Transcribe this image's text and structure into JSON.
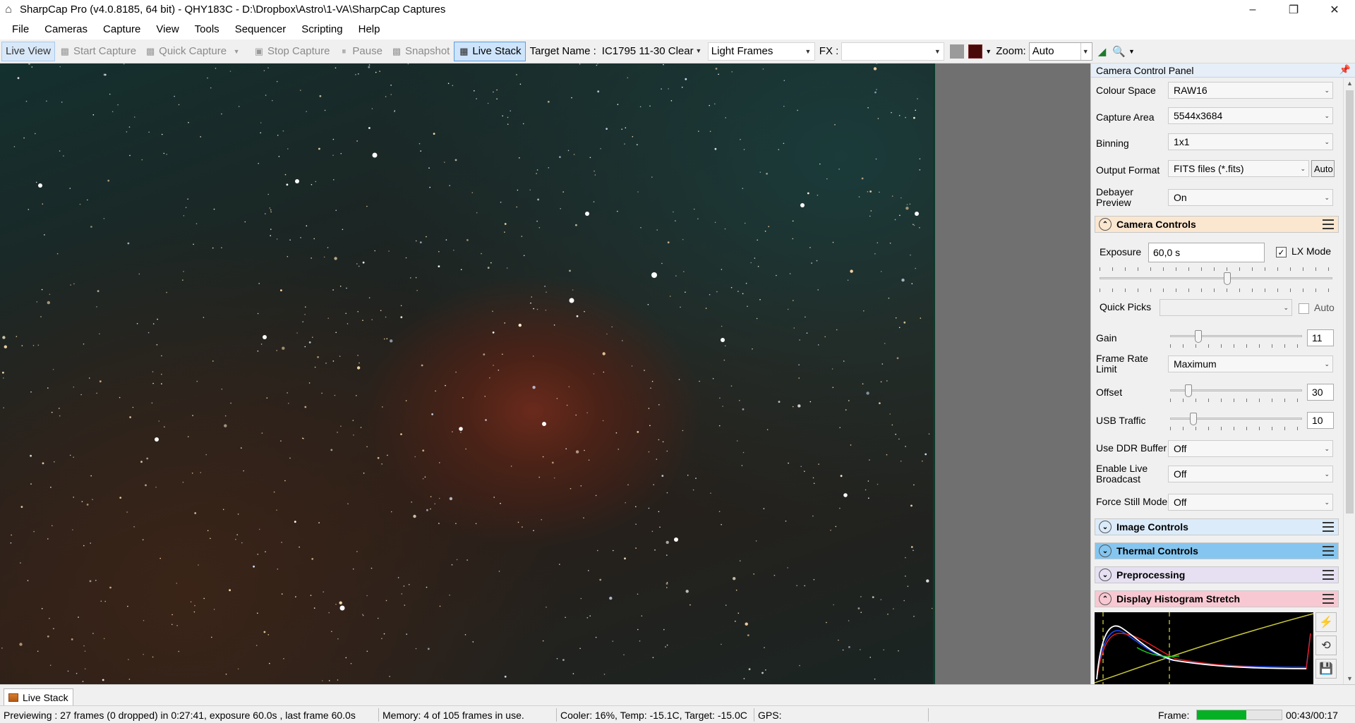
{
  "window": {
    "title": "SharpCap Pro (v4.0.8185, 64 bit) - QHY183C - D:\\Dropbox\\Astro\\1-VA\\SharpCap Captures"
  },
  "menu": [
    "File",
    "Cameras",
    "Capture",
    "View",
    "Tools",
    "Sequencer",
    "Scripting",
    "Help"
  ],
  "toolbar": {
    "live_view": "Live View",
    "start_capture": "Start Capture",
    "quick_capture": "Quick Capture",
    "stop_capture": "Stop Capture",
    "pause": "Pause",
    "snapshot": "Snapshot",
    "live_stack": "Live Stack",
    "target_name_label": "Target Name :",
    "target_name_value": "IC1795 11-30 Clear",
    "frame_type": "Light Frames",
    "fx_label": "FX :",
    "fx_value": "",
    "zoom_label": "Zoom:",
    "zoom_value": "Auto"
  },
  "panel": {
    "title": "Camera Control Panel",
    "colour_space": {
      "label": "Colour Space",
      "value": "RAW16"
    },
    "capture_area": {
      "label": "Capture Area",
      "value": "5544x3684"
    },
    "binning": {
      "label": "Binning",
      "value": "1x1"
    },
    "output_format": {
      "label": "Output Format",
      "value": "FITS files (*.fits)",
      "auto": "Auto"
    },
    "debayer": {
      "label1": "Debayer",
      "label2": "Preview",
      "value": "On"
    },
    "camera_controls": {
      "title": "Camera Controls",
      "color": "#fbe6cf"
    },
    "exposure": {
      "label": "Exposure",
      "value": "60,0 s",
      "lx_label": "LX Mode",
      "lx_checked": true,
      "slider_fraction": 0.55
    },
    "quick_picks": {
      "label": "Quick Picks",
      "value": "",
      "auto": "Auto"
    },
    "gain": {
      "label": "Gain",
      "value": "11",
      "fraction": 0.2
    },
    "frame_rate": {
      "label1": "Frame Rate",
      "label2": "Limit",
      "value": "Maximum"
    },
    "offset": {
      "label": "Offset",
      "value": "30",
      "fraction": 0.12
    },
    "usb": {
      "label": "USB Traffic",
      "value": "10",
      "fraction": 0.16
    },
    "ddr": {
      "label": "Use DDR Buffer",
      "value": "Off"
    },
    "broadcast": {
      "label1": "Enable Live",
      "label2": "Broadcast",
      "value": "Off"
    },
    "still": {
      "label": "Force Still Mode",
      "value": "Off"
    },
    "sections": [
      {
        "title": "Image Controls",
        "color": "#dcebf9"
      },
      {
        "title": "Thermal Controls",
        "color": "#85c6f0"
      },
      {
        "title": "Preprocessing",
        "color": "#e6e0f2"
      },
      {
        "title": "Display Histogram Stretch",
        "color": "#f8c8d2"
      }
    ]
  },
  "bottom_tab": "Live Stack",
  "status": {
    "preview": "Previewing : 27 frames (0 dropped) in 0:27:41, exposure 60.0s , last frame 60.0s",
    "memory": "Memory: 4 of 105 frames in use.",
    "cooler": "Cooler: 16%, Temp: -15.1C, Target: -15.0C",
    "gps": "GPS:",
    "frame_label": "Frame:",
    "frame_progress": 0.58,
    "time": "00:43/00:17"
  }
}
